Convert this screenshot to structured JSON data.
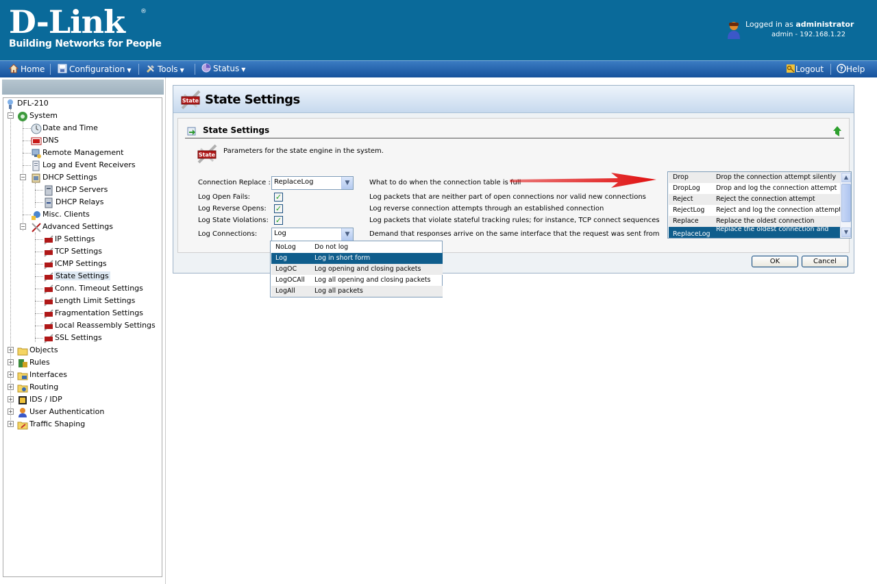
{
  "header": {
    "logo_text": "D-Link",
    "logo_reg": "®",
    "tagline": "Building Networks for People",
    "logged_in_prefix": "Logged in as ",
    "logged_in_user": "administrator",
    "session": "admin - 192.168.1.22"
  },
  "menu": {
    "home": "Home",
    "configuration": "Configuration",
    "tools": "Tools",
    "status": "Status",
    "logout": "Logout",
    "help": "Help"
  },
  "tree": {
    "root": "DFL-210",
    "system": "System",
    "date_time": "Date and Time",
    "dns": "DNS",
    "remote_mgmt": "Remote Management",
    "log_receivers": "Log and Event Receivers",
    "dhcp_settings": "DHCP Settings",
    "dhcp_servers": "DHCP Servers",
    "dhcp_relays": "DHCP Relays",
    "misc_clients": "Misc. Clients",
    "advanced": "Advanced Settings",
    "ip_settings": "IP Settings",
    "tcp_settings": "TCP Settings",
    "icmp_settings": "ICMP Settings",
    "state_settings": "State Settings",
    "conn_timeout": "Conn. Timeout Settings",
    "length_limit": "Length Limit Settings",
    "fragmentation": "Fragmentation Settings",
    "local_reassembly": "Local Reassembly Settings",
    "ssl_settings": "SSL Settings",
    "objects": "Objects",
    "rules": "Rules",
    "interfaces": "Interfaces",
    "routing": "Routing",
    "ids_idp": "IDS / IDP",
    "user_auth": "User Authentication",
    "traffic_shaping": "Traffic Shaping"
  },
  "main": {
    "page_title": "State Settings",
    "section_title": "State Settings",
    "params_text": "Parameters for the state engine in the system.",
    "fields": {
      "connection_replace_label": "Connection Replace :",
      "connection_replace_value": "ReplaceLog",
      "connection_replace_desc": "What to do when the connection table is full",
      "log_open_fails_label": "Log Open Fails:",
      "log_open_fails_desc": "Log packets that are neither part of open connections nor valid new connections",
      "log_reverse_opens_label": "Log Reverse Opens:",
      "log_reverse_opens_desc": "Log reverse connection attempts through an established connection",
      "log_state_violations_label": "Log State Violations:",
      "log_state_violations_desc": "Log packets that violate stateful tracking rules; for instance, TCP connect sequences",
      "log_connections_label": "Log Connections:",
      "log_connections_value": "Log",
      "log_connections_desc": "Demand that responses arrive on the same interface that the request was sent from"
    },
    "ok_label": "OK",
    "cancel_label": "Cancel"
  },
  "log_dropdown": [
    {
      "code": "NoLog",
      "desc": "Do not log"
    },
    {
      "code": "Log",
      "desc": "Log in short form"
    },
    {
      "code": "LogOC",
      "desc": "Log opening and closing packets"
    },
    {
      "code": "LogOCAll",
      "desc": "Log all opening and closing packets"
    },
    {
      "code": "LogAll",
      "desc": "Log all packets"
    }
  ],
  "replace_dropdown": [
    {
      "code": "Drop",
      "desc": "Drop the connection attempt silently"
    },
    {
      "code": "DropLog",
      "desc": "Drop and log the connection attempt"
    },
    {
      "code": "Reject",
      "desc": "Reject the connection attempt"
    },
    {
      "code": "RejectLog",
      "desc": "Reject and log the connection attempt"
    },
    {
      "code": "Replace",
      "desc": "Replace the oldest connection"
    },
    {
      "code": "ReplaceLog",
      "desc": "Replace the oldest connection and"
    }
  ],
  "colors": {
    "header_bg": "#0a6a9a",
    "menu_bg": "#16529c",
    "highlight": "#0f5d8c",
    "arrow": "#e01010"
  }
}
